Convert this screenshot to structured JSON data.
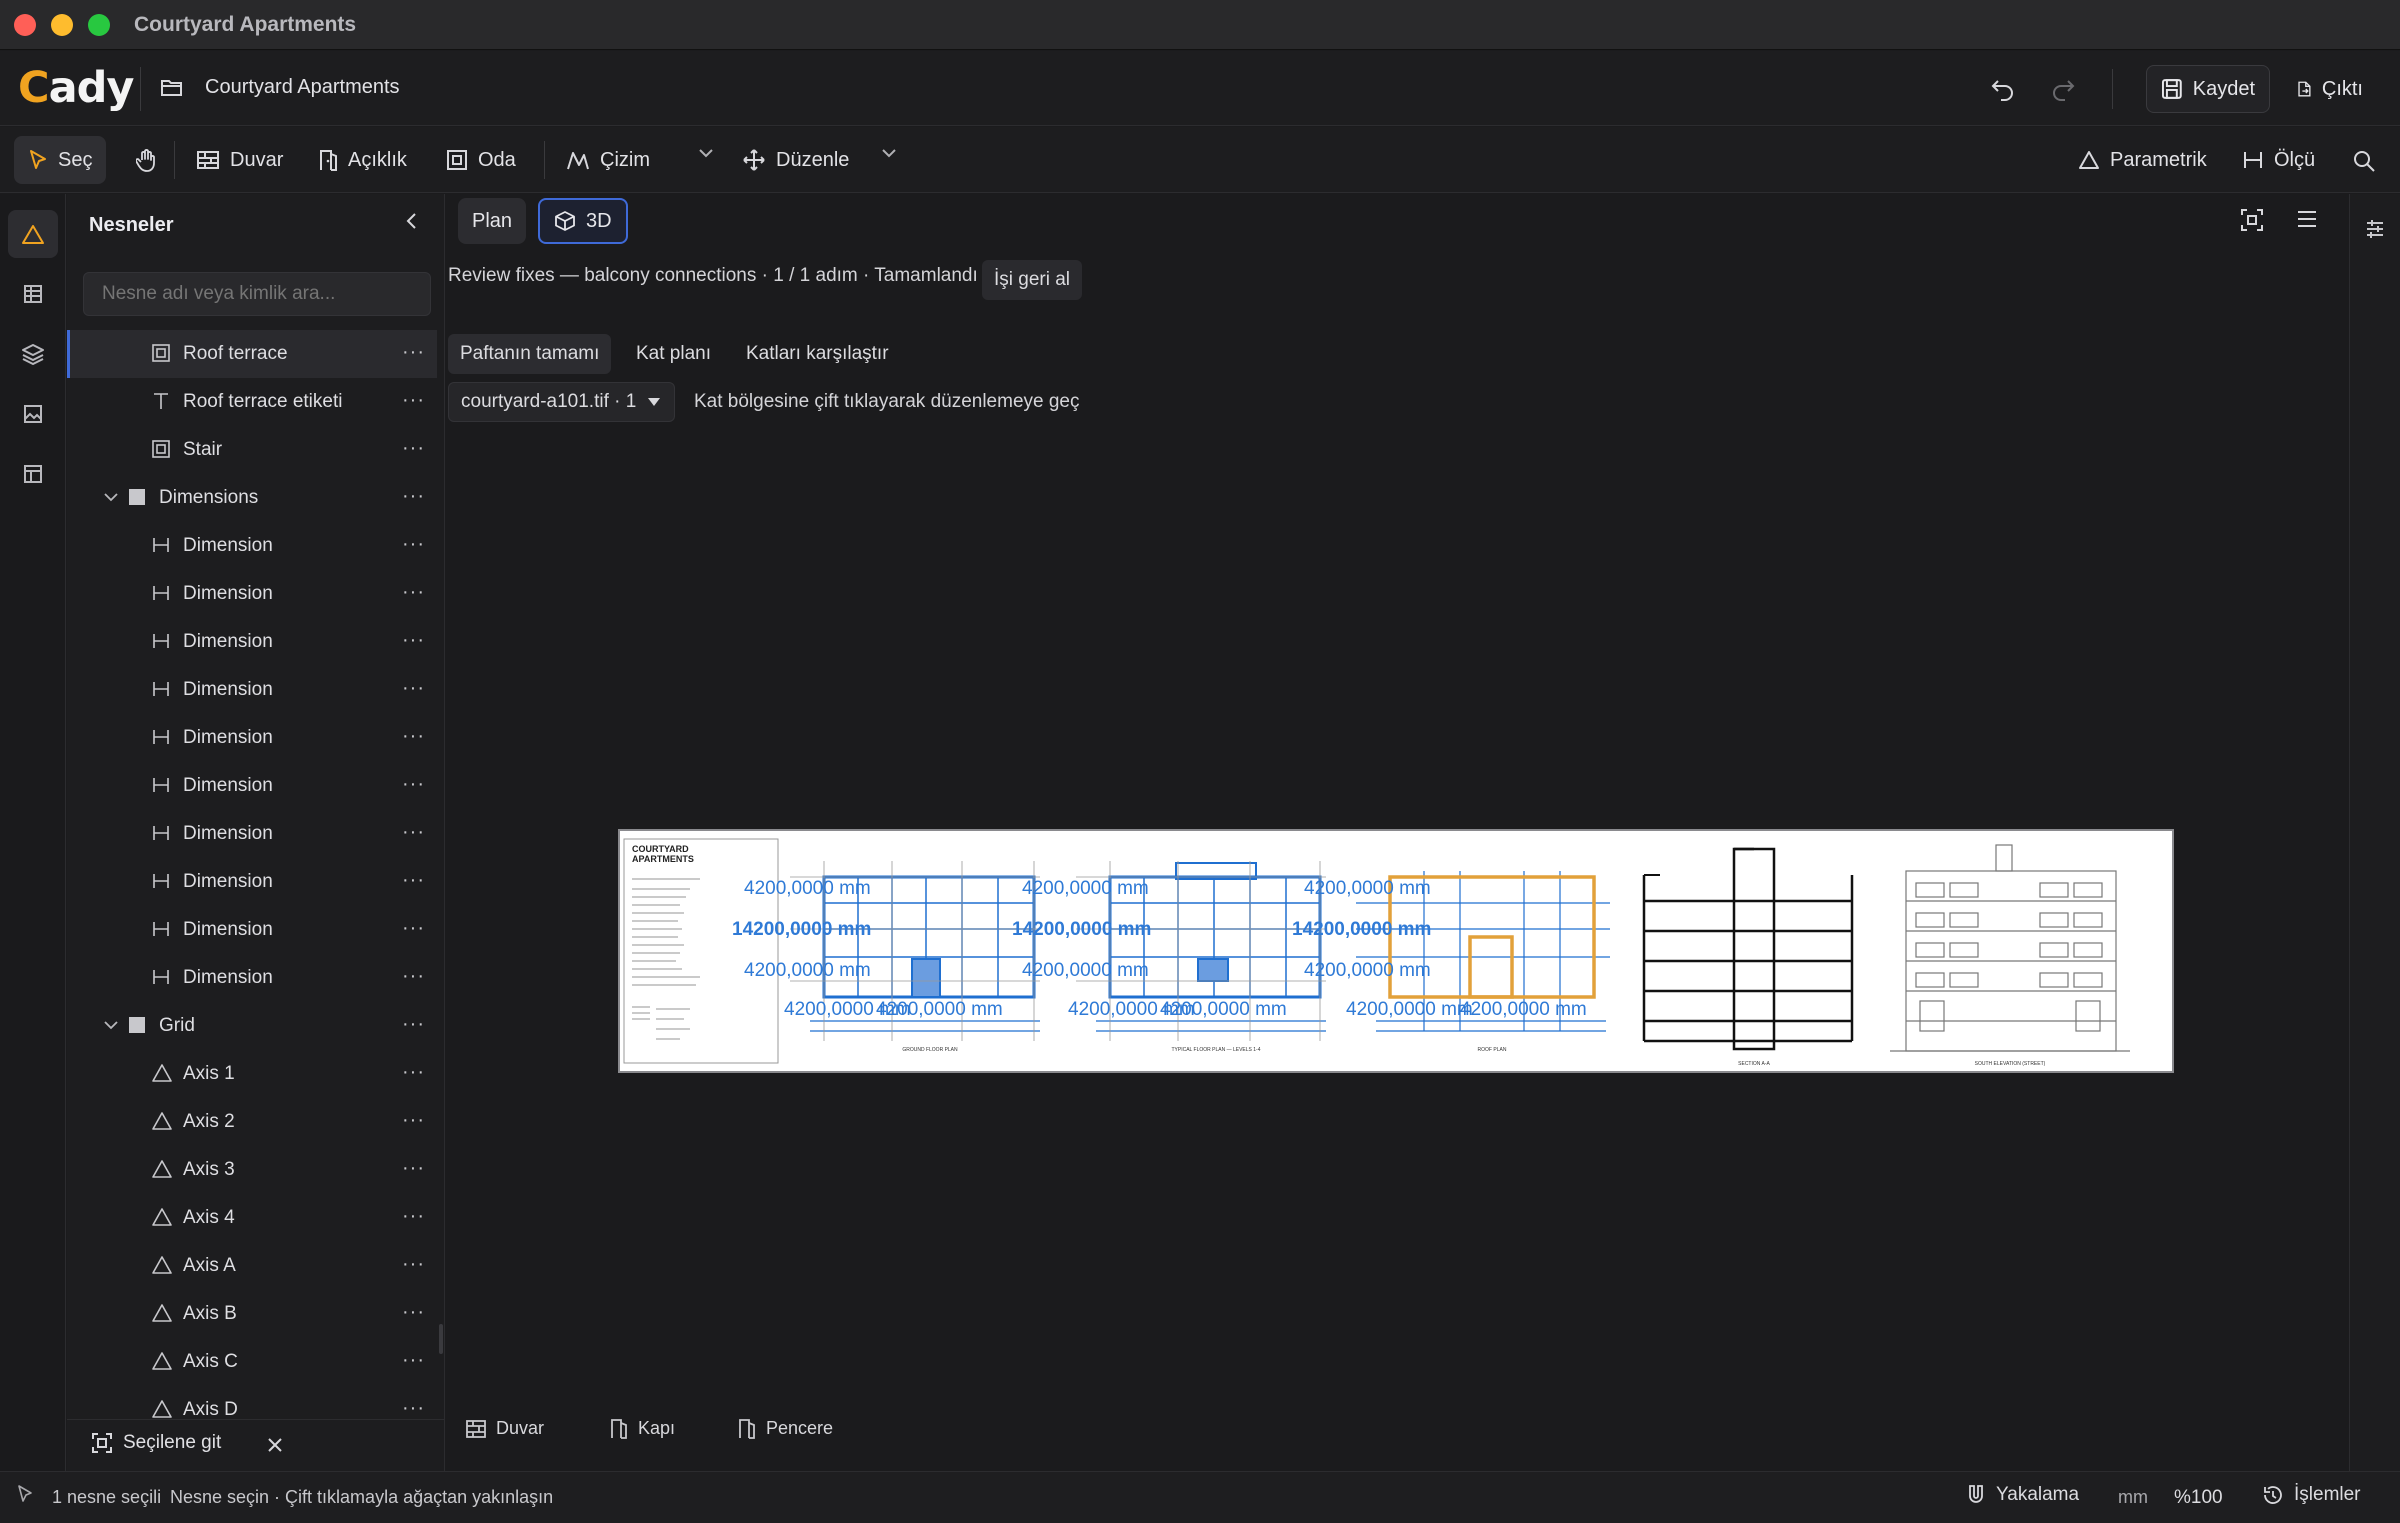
{
  "window": {
    "title": "Courtyard Apartments"
  },
  "header": {
    "logo_text": "ady",
    "logo_letter": "C",
    "project_name": "Courtyard Apartments",
    "save_label": "Kaydet",
    "output_label": "Çıktı"
  },
  "toolbar": {
    "select": "Seç",
    "wall": "Duvar",
    "opening": "Açıklık",
    "room": "Oda",
    "draw": "Çizim",
    "edit": "Düzenle",
    "parametric": "Parametrik",
    "measure": "Ölçü"
  },
  "panel": {
    "title": "Nesneler",
    "search_placeholder": "Nesne adı veya kimlik ara...",
    "items": [
      {
        "label": "Roof terrace",
        "icon": "room-icon",
        "indent": 1,
        "selected": true
      },
      {
        "label": "Roof terrace etiketi",
        "icon": "text-icon",
        "indent": 1
      },
      {
        "label": "Stair",
        "icon": "room-icon",
        "indent": 1
      },
      {
        "label": "Dimensions",
        "icon": "group-icon",
        "indent": 0,
        "expanded": true
      },
      {
        "label": "Dimension",
        "icon": "dimension-icon",
        "indent": 1
      },
      {
        "label": "Dimension",
        "icon": "dimension-icon",
        "indent": 1
      },
      {
        "label": "Dimension",
        "icon": "dimension-icon",
        "indent": 1
      },
      {
        "label": "Dimension",
        "icon": "dimension-icon",
        "indent": 1
      },
      {
        "label": "Dimension",
        "icon": "dimension-icon",
        "indent": 1
      },
      {
        "label": "Dimension",
        "icon": "dimension-icon",
        "indent": 1
      },
      {
        "label": "Dimension",
        "icon": "dimension-icon",
        "indent": 1
      },
      {
        "label": "Dimension",
        "icon": "dimension-icon",
        "indent": 1
      },
      {
        "label": "Dimension",
        "icon": "dimension-icon",
        "indent": 1
      },
      {
        "label": "Dimension",
        "icon": "dimension-icon",
        "indent": 1
      },
      {
        "label": "Grid",
        "icon": "group-icon",
        "indent": 0,
        "expanded": true
      },
      {
        "label": "Axis 1",
        "icon": "axis-icon",
        "indent": 1
      },
      {
        "label": "Axis 2",
        "icon": "axis-icon",
        "indent": 1
      },
      {
        "label": "Axis 3",
        "icon": "axis-icon",
        "indent": 1
      },
      {
        "label": "Axis 4",
        "icon": "axis-icon",
        "indent": 1
      },
      {
        "label": "Axis A",
        "icon": "axis-icon",
        "indent": 1
      },
      {
        "label": "Axis B",
        "icon": "axis-icon",
        "indent": 1
      },
      {
        "label": "Axis C",
        "icon": "axis-icon",
        "indent": 1
      },
      {
        "label": "Axis D",
        "icon": "axis-icon",
        "indent": 1
      }
    ],
    "goto_selected": "Seçilene git"
  },
  "main": {
    "view_plan": "Plan",
    "view_3d": "3D",
    "review_text": "Review fixes — balcony connections · 1 / 1 adım · Tamamlandı",
    "undo_job": "İşi geri al",
    "sheet_tabs": [
      "Paftanın tamamı",
      "Kat planı",
      "Katları karşılaştır"
    ],
    "file_select": "courtyard-a101.tif · 1",
    "hint": "Kat bölgesine çift tıklayarak düzenlemeye geç",
    "quick_add": [
      "Duvar",
      "Kapı",
      "Pencere"
    ],
    "drawing": {
      "title_line1": "COURTYARD",
      "title_line2": "APARTMENTS",
      "dim_label": "4200,0000 mm",
      "dim_label_wide": "14200,0000 mm",
      "plan_titles": [
        "GROUND FLOOR PLAN",
        "TYPICAL FLOOR PLAN — LEVELS 1-4",
        "ROOF PLAN",
        "SECTION A-A",
        "SOUTH ELEVATION (STREET)"
      ]
    }
  },
  "status": {
    "selection": "1 nesne seçili",
    "hint": "Nesne seçin · Çift tıklamayla ağaçtan yakınlaşın",
    "snap": "Yakalama",
    "unit": "mm",
    "zoom": "%100",
    "history": "İşlemler"
  },
  "colors": {
    "accent_blue": "#3f6ad8",
    "logo_orange": "#f0a320",
    "plan_blue": "#1f6fd0",
    "highlight_orange": "#e2a13a"
  }
}
